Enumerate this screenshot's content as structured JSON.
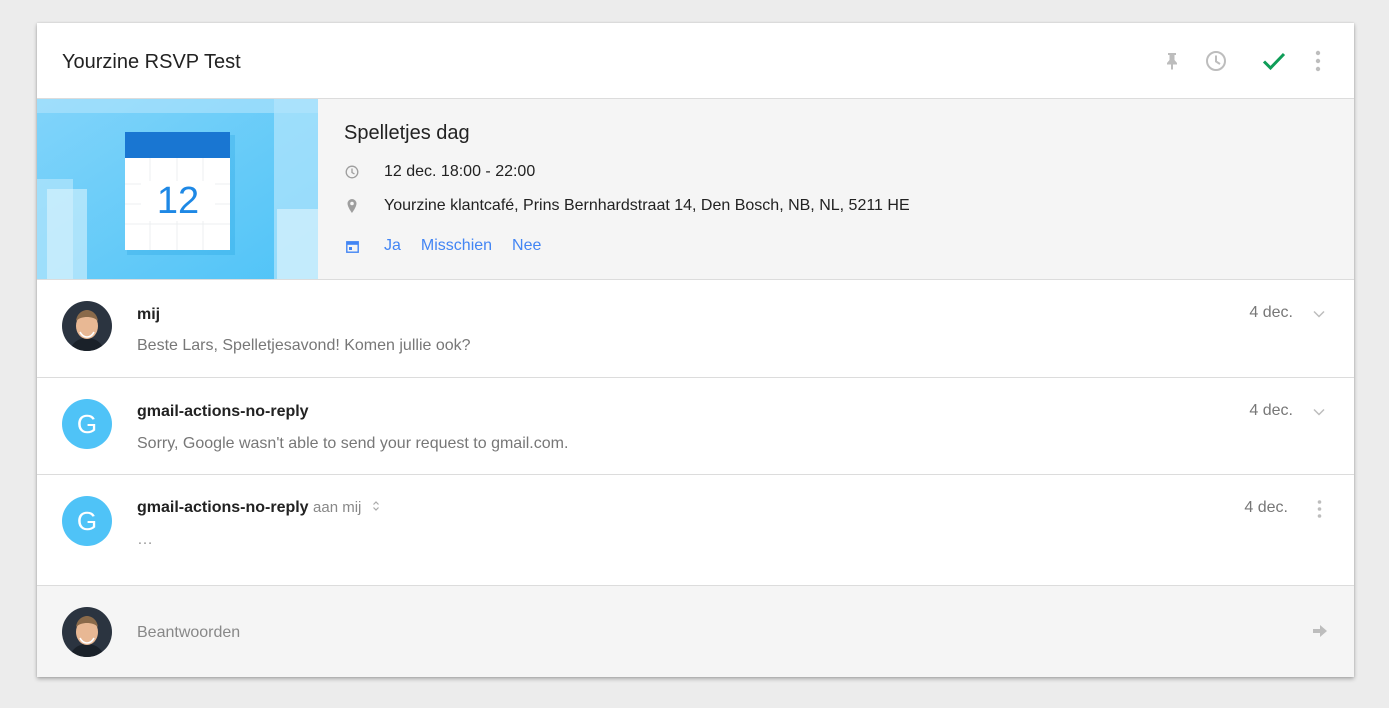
{
  "thread": {
    "title": "Yourzine RSVP Test",
    "icons": [
      "pin-icon",
      "clock-icon",
      "check-icon",
      "more-vert-icon"
    ],
    "accent_check": "#0f9d58"
  },
  "event": {
    "image_day": "12",
    "title": "Spelletjes dag",
    "time": "12 dec. 18:00 - 22:00",
    "location": "Yourzine klantcafé, Prins Bernhardstraat 14, Den Bosch, NB, NL, 5211 HE",
    "rsvp": {
      "yes": "Ja",
      "maybe": "Misschien",
      "no": "Nee"
    },
    "rsvp_color": "#4285f4"
  },
  "messages": [
    {
      "sender": "mij",
      "snippet": "Beste Lars, Spelletjesavond! Komen jullie ook?",
      "date": "4 dec."
    },
    {
      "avatar_letter": "G",
      "sender": "gmail-actions-no-reply",
      "snippet": "Sorry, Google wasn't able to send your request to gmail.com.",
      "date": "4 dec."
    },
    {
      "avatar_letter": "G",
      "sender": "gmail-actions-no-reply",
      "recipient": "aan mij",
      "snippet": "…",
      "date": "4 dec."
    }
  ],
  "reply": {
    "placeholder": "Beantwoorden"
  }
}
